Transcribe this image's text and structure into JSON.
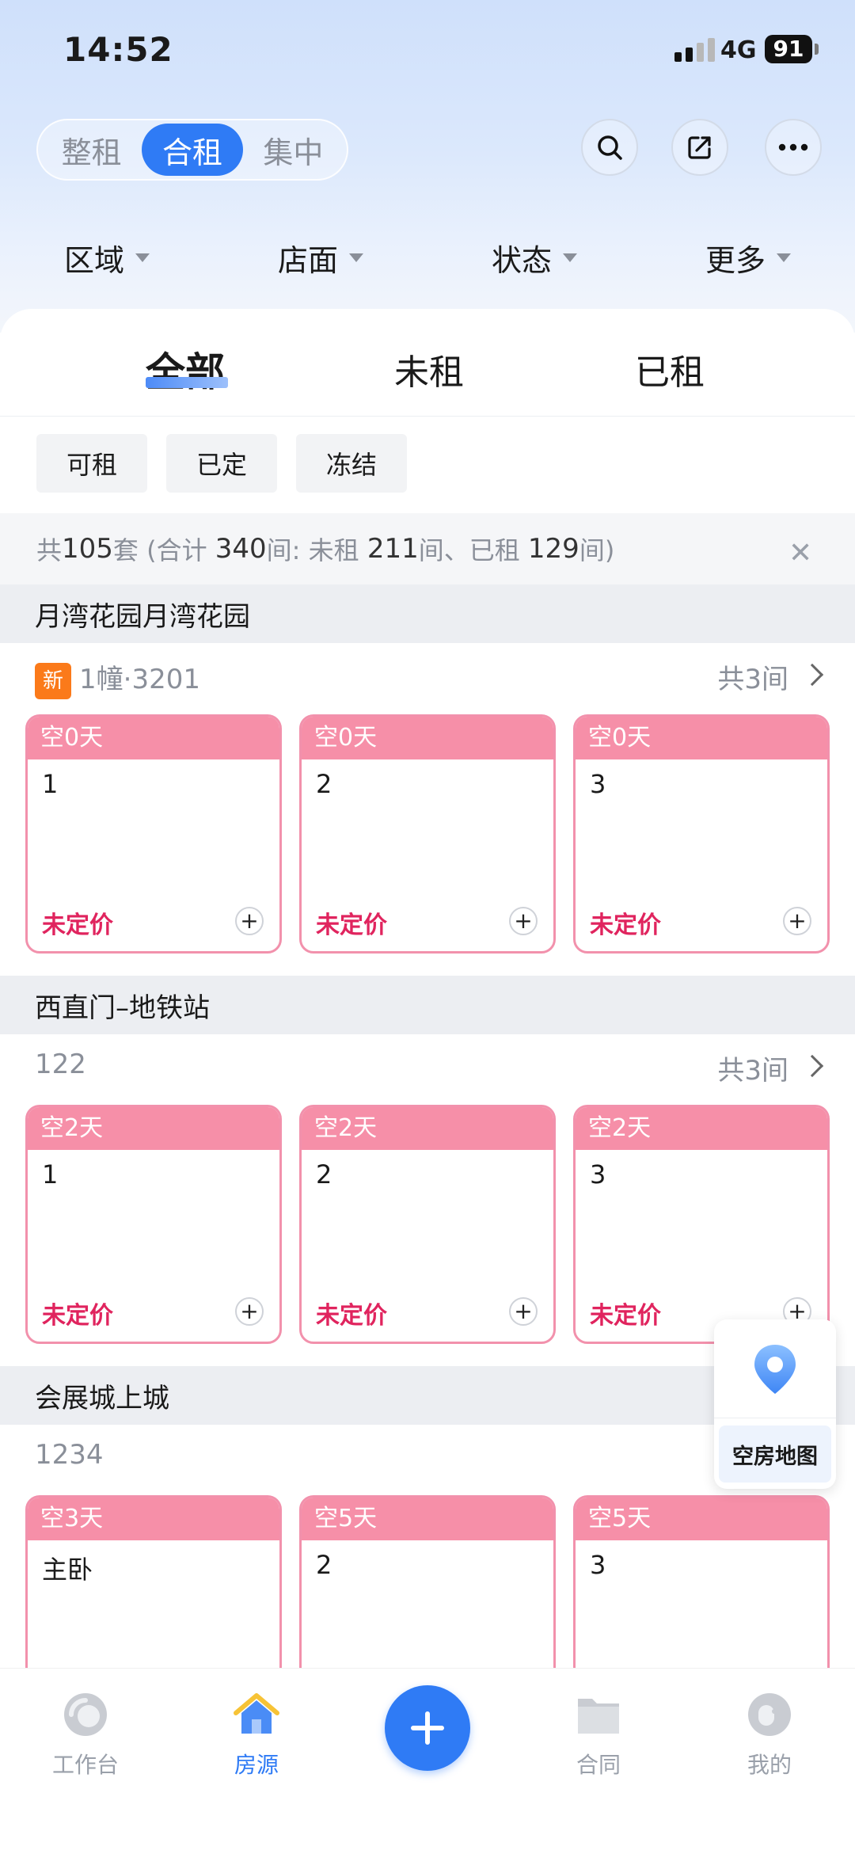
{
  "status_bar": {
    "time": "14:52",
    "network": "4G",
    "battery": "91"
  },
  "mode_switch": {
    "items": [
      "整租",
      "合租",
      "集中"
    ],
    "active": "合租"
  },
  "filters": [
    "区域",
    "店面",
    "状态",
    "更多"
  ],
  "status_tabs": [
    "全部",
    "未租",
    "已租"
  ],
  "chips": [
    "可租",
    "已定",
    "冻结"
  ],
  "summary": {
    "prefix": "共",
    "total_sets": "105",
    "mid1": "套 (合计",
    "total_rooms": "340",
    "mid2": "间:  未租",
    "unrented": "211",
    "mid3": "间、已租",
    "rented": "129",
    "suffix": "间)"
  },
  "groups": [
    {
      "name": "月湾花园月湾花园",
      "badge": "新",
      "unit": "1幢·3201",
      "count": "共3间",
      "rooms": [
        {
          "vacancy": "空0天",
          "name": "1",
          "price": "未定价"
        },
        {
          "vacancy": "空0天",
          "name": "2",
          "price": "未定价"
        },
        {
          "vacancy": "空0天",
          "name": "3",
          "price": "未定价"
        }
      ]
    },
    {
      "name": "西直门–地铁站",
      "unit": "122",
      "count": "共3间",
      "rooms": [
        {
          "vacancy": "空2天",
          "name": "1",
          "price": "未定价"
        },
        {
          "vacancy": "空2天",
          "name": "2",
          "price": "未定价"
        },
        {
          "vacancy": "空2天",
          "name": "3",
          "price": "未定价"
        }
      ]
    },
    {
      "name": "会展城上城",
      "unit": "1234",
      "rooms": [
        {
          "vacancy": "空3天",
          "name": "主卧"
        },
        {
          "vacancy": "空5天",
          "name": "2"
        },
        {
          "vacancy": "空5天",
          "name": "3"
        }
      ]
    }
  ],
  "float_map": {
    "label": "空房地图"
  },
  "tabbar": {
    "items": [
      "工作台",
      "房源",
      "合同",
      "我的"
    ],
    "active": "房源"
  },
  "colors": {
    "accent": "#2f7bf5",
    "room_header": "#f68fa8",
    "price": "#e0245e",
    "new_badge": "#fb7a1a"
  }
}
